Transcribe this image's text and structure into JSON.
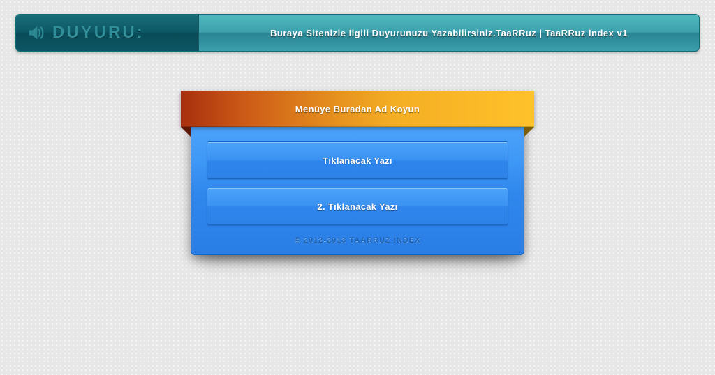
{
  "announcement": {
    "label": "Duyuru:",
    "message": "Buraya Sitenizle İlgili Duyurunuzu Yazabilirsiniz.TaaRRuz | TaaRRuz İndex v1"
  },
  "menu": {
    "title": "Menüye Buradan Ad Koyun",
    "items": [
      {
        "label": "Tıklanacak Yazı"
      },
      {
        "label": "2. Tıklanacak Yazı"
      }
    ]
  },
  "footer": "© 2012-2013 TaaRRuz İndex"
}
